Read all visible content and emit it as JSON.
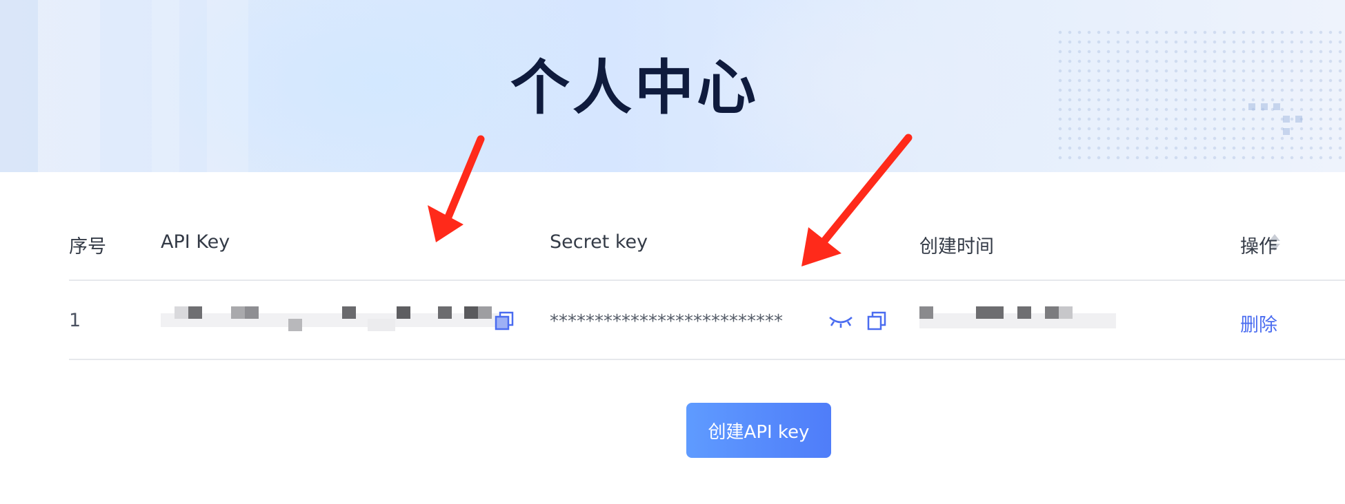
{
  "header": {
    "title": "个人中心"
  },
  "table": {
    "columns": {
      "index": "序号",
      "api_key": "API Key",
      "secret_key": "Secret key",
      "created_at": "创建时间",
      "actions": "操作"
    },
    "rows": [
      {
        "index": "1",
        "secret_key_masked": "**************************",
        "delete_label": "删除"
      }
    ]
  },
  "actions": {
    "create_button_label": "创建API key"
  },
  "colors": {
    "accent": "#4a6cf0",
    "annotation_arrow": "#ff2a1a",
    "title": "#0f1b3d"
  },
  "icons": [
    "copy-icon",
    "eye-closed-icon",
    "sort-icon",
    "annotation-arrow"
  ]
}
